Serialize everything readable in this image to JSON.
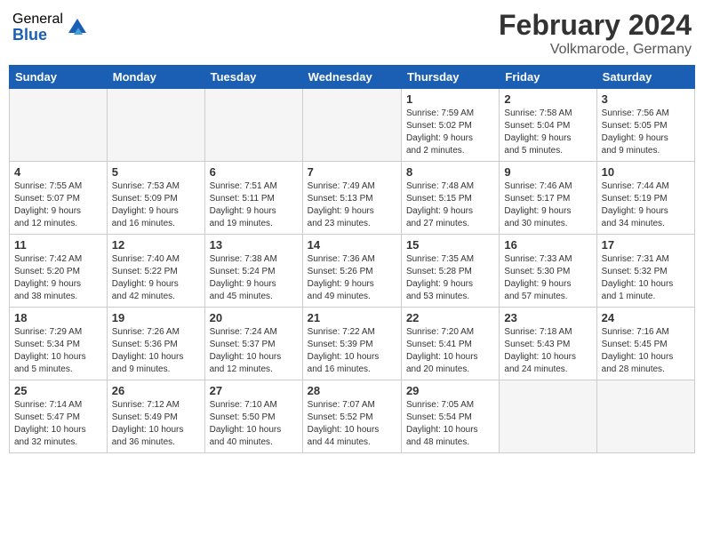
{
  "logo": {
    "general": "General",
    "blue": "Blue"
  },
  "header": {
    "title": "February 2024",
    "subtitle": "Volkmarode, Germany"
  },
  "days_of_week": [
    "Sunday",
    "Monday",
    "Tuesday",
    "Wednesday",
    "Thursday",
    "Friday",
    "Saturday"
  ],
  "weeks": [
    [
      {
        "day": "",
        "info": ""
      },
      {
        "day": "",
        "info": ""
      },
      {
        "day": "",
        "info": ""
      },
      {
        "day": "",
        "info": ""
      },
      {
        "day": "1",
        "info": "Sunrise: 7:59 AM\nSunset: 5:02 PM\nDaylight: 9 hours\nand 2 minutes."
      },
      {
        "day": "2",
        "info": "Sunrise: 7:58 AM\nSunset: 5:04 PM\nDaylight: 9 hours\nand 5 minutes."
      },
      {
        "day": "3",
        "info": "Sunrise: 7:56 AM\nSunset: 5:05 PM\nDaylight: 9 hours\nand 9 minutes."
      }
    ],
    [
      {
        "day": "4",
        "info": "Sunrise: 7:55 AM\nSunset: 5:07 PM\nDaylight: 9 hours\nand 12 minutes."
      },
      {
        "day": "5",
        "info": "Sunrise: 7:53 AM\nSunset: 5:09 PM\nDaylight: 9 hours\nand 16 minutes."
      },
      {
        "day": "6",
        "info": "Sunrise: 7:51 AM\nSunset: 5:11 PM\nDaylight: 9 hours\nand 19 minutes."
      },
      {
        "day": "7",
        "info": "Sunrise: 7:49 AM\nSunset: 5:13 PM\nDaylight: 9 hours\nand 23 minutes."
      },
      {
        "day": "8",
        "info": "Sunrise: 7:48 AM\nSunset: 5:15 PM\nDaylight: 9 hours\nand 27 minutes."
      },
      {
        "day": "9",
        "info": "Sunrise: 7:46 AM\nSunset: 5:17 PM\nDaylight: 9 hours\nand 30 minutes."
      },
      {
        "day": "10",
        "info": "Sunrise: 7:44 AM\nSunset: 5:19 PM\nDaylight: 9 hours\nand 34 minutes."
      }
    ],
    [
      {
        "day": "11",
        "info": "Sunrise: 7:42 AM\nSunset: 5:20 PM\nDaylight: 9 hours\nand 38 minutes."
      },
      {
        "day": "12",
        "info": "Sunrise: 7:40 AM\nSunset: 5:22 PM\nDaylight: 9 hours\nand 42 minutes."
      },
      {
        "day": "13",
        "info": "Sunrise: 7:38 AM\nSunset: 5:24 PM\nDaylight: 9 hours\nand 45 minutes."
      },
      {
        "day": "14",
        "info": "Sunrise: 7:36 AM\nSunset: 5:26 PM\nDaylight: 9 hours\nand 49 minutes."
      },
      {
        "day": "15",
        "info": "Sunrise: 7:35 AM\nSunset: 5:28 PM\nDaylight: 9 hours\nand 53 minutes."
      },
      {
        "day": "16",
        "info": "Sunrise: 7:33 AM\nSunset: 5:30 PM\nDaylight: 9 hours\nand 57 minutes."
      },
      {
        "day": "17",
        "info": "Sunrise: 7:31 AM\nSunset: 5:32 PM\nDaylight: 10 hours\nand 1 minute."
      }
    ],
    [
      {
        "day": "18",
        "info": "Sunrise: 7:29 AM\nSunset: 5:34 PM\nDaylight: 10 hours\nand 5 minutes."
      },
      {
        "day": "19",
        "info": "Sunrise: 7:26 AM\nSunset: 5:36 PM\nDaylight: 10 hours\nand 9 minutes."
      },
      {
        "day": "20",
        "info": "Sunrise: 7:24 AM\nSunset: 5:37 PM\nDaylight: 10 hours\nand 12 minutes."
      },
      {
        "day": "21",
        "info": "Sunrise: 7:22 AM\nSunset: 5:39 PM\nDaylight: 10 hours\nand 16 minutes."
      },
      {
        "day": "22",
        "info": "Sunrise: 7:20 AM\nSunset: 5:41 PM\nDaylight: 10 hours\nand 20 minutes."
      },
      {
        "day": "23",
        "info": "Sunrise: 7:18 AM\nSunset: 5:43 PM\nDaylight: 10 hours\nand 24 minutes."
      },
      {
        "day": "24",
        "info": "Sunrise: 7:16 AM\nSunset: 5:45 PM\nDaylight: 10 hours\nand 28 minutes."
      }
    ],
    [
      {
        "day": "25",
        "info": "Sunrise: 7:14 AM\nSunset: 5:47 PM\nDaylight: 10 hours\nand 32 minutes."
      },
      {
        "day": "26",
        "info": "Sunrise: 7:12 AM\nSunset: 5:49 PM\nDaylight: 10 hours\nand 36 minutes."
      },
      {
        "day": "27",
        "info": "Sunrise: 7:10 AM\nSunset: 5:50 PM\nDaylight: 10 hours\nand 40 minutes."
      },
      {
        "day": "28",
        "info": "Sunrise: 7:07 AM\nSunset: 5:52 PM\nDaylight: 10 hours\nand 44 minutes."
      },
      {
        "day": "29",
        "info": "Sunrise: 7:05 AM\nSunset: 5:54 PM\nDaylight: 10 hours\nand 48 minutes."
      },
      {
        "day": "",
        "info": ""
      },
      {
        "day": "",
        "info": ""
      }
    ]
  ]
}
